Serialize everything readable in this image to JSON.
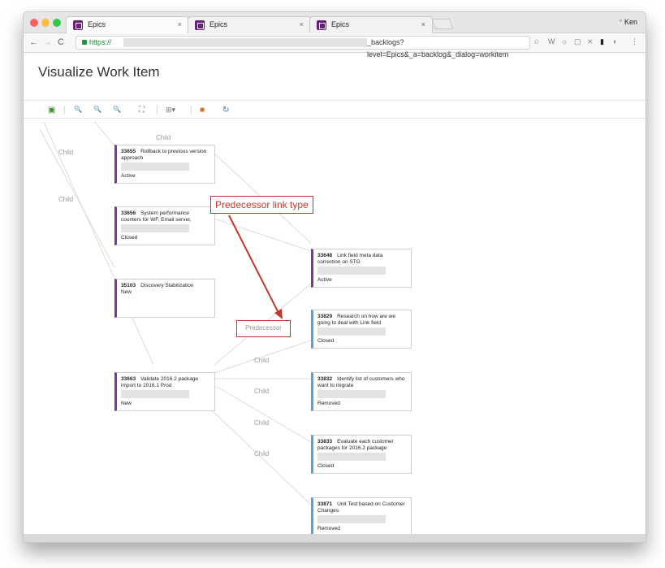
{
  "browser": {
    "tabs": [
      {
        "title": "Epics",
        "close": "×"
      },
      {
        "title": "Epics",
        "close": "×"
      },
      {
        "title": "Epics",
        "close": "×"
      }
    ],
    "profile_name": "Ken",
    "url_scheme": "https://",
    "url_path": "_backlogs?level=Epics&_a=backlog&_dialog=workitem",
    "nav": {
      "back": "←",
      "forward": "→",
      "reload": "C"
    },
    "ext_icons": [
      "☆",
      "W",
      "☼",
      "▢",
      "⨯",
      "▮",
      "◐",
      "⋮"
    ]
  },
  "page": {
    "title": "Visualize Work Item"
  },
  "toolbar": {
    "icons": [
      "▣",
      "|",
      "🔍",
      "🔍",
      "🔍",
      "⛶",
      "|",
      "⊞▾",
      "|",
      "■",
      "↻"
    ]
  },
  "graph": {
    "cards": [
      {
        "id": "33655",
        "title": "Rollback to previous version approach",
        "state": "Active",
        "kind": "feature"
      },
      {
        "id": "33656",
        "title": "System performance counters for WF, Email server,",
        "state": "Closed",
        "kind": "feature"
      },
      {
        "id": "35103",
        "title": "Discovery Stabilization",
        "state": "New",
        "kind": "feature"
      },
      {
        "id": "33663",
        "title": "Validate 2016.2 package import to 2016.1 Prod",
        "state": "New",
        "kind": "feature"
      },
      {
        "id": "33648",
        "title": "Link field meta data correction on STG",
        "state": "Active",
        "kind": "feature"
      },
      {
        "id": "33829",
        "title": "Research on how are we going to deal with Link field",
        "state": "Closed",
        "kind": "task"
      },
      {
        "id": "33832",
        "title": "Identify list of customers who want to migrate",
        "state": "Removed",
        "kind": "task"
      },
      {
        "id": "33833",
        "title": "Evaluate each customer packages for 2016.2 package",
        "state": "Closed",
        "kind": "task"
      },
      {
        "id": "33871",
        "title": "Unit Test based on Customer Changes.",
        "state": "Removed",
        "kind": "task"
      }
    ],
    "edge_labels": [
      "Child",
      "Child",
      "Child",
      "Child",
      "Child",
      "Child",
      "Child"
    ],
    "predecessor_label": "Predecessor",
    "callout": "Predecessor link type"
  },
  "colors": {
    "feature_accent": "#773b93",
    "task_accent": "#5d9fd0",
    "annotation_red": "#c0392b"
  }
}
